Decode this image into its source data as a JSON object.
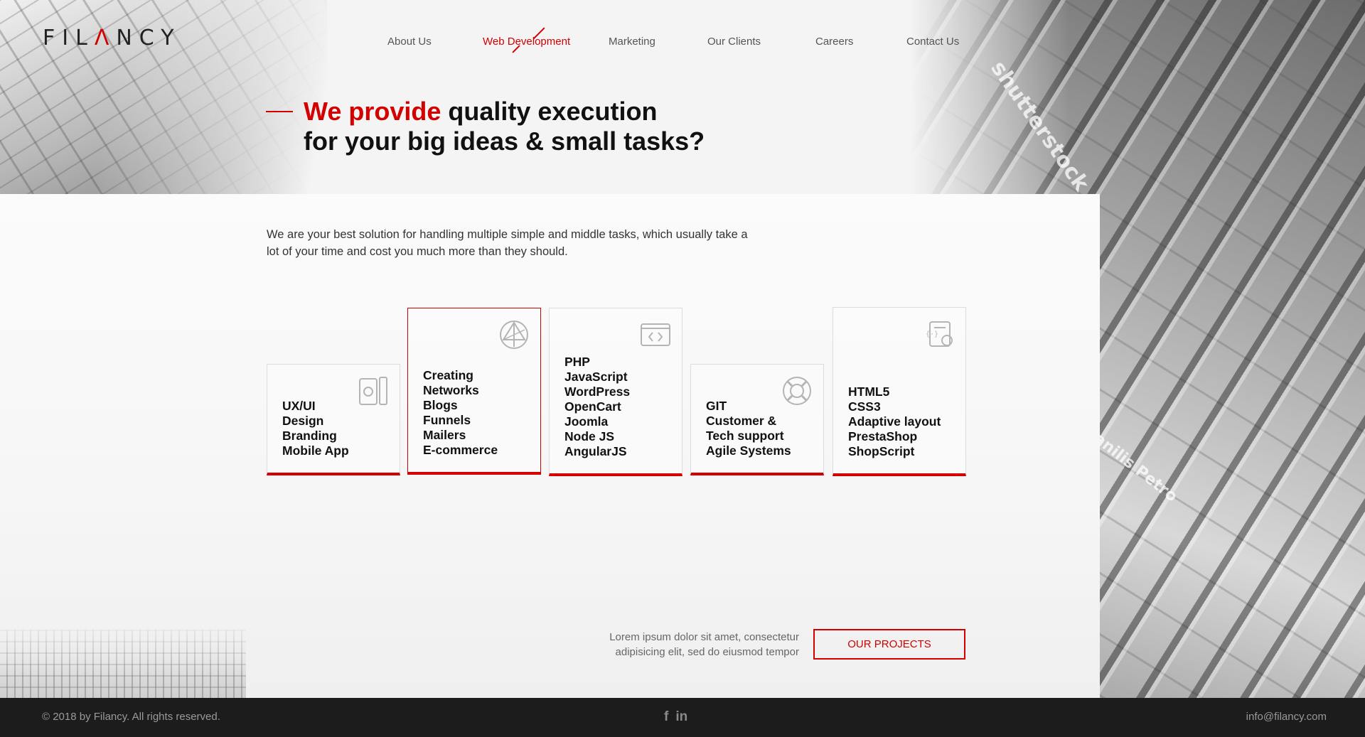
{
  "brand": {
    "logo_text_a": "FIL",
    "logo_text_accent": "Λ",
    "logo_text_b": "NCY",
    "accent_color": "#d40000"
  },
  "nav": {
    "items": [
      {
        "label": "About Us"
      },
      {
        "label": "Web Development"
      },
      {
        "label": "Marketing"
      },
      {
        "label": "Our Clients"
      },
      {
        "label": "Careers"
      },
      {
        "label": "Contact Us"
      }
    ],
    "active": "Web Development"
  },
  "hero": {
    "title_red": "We provide",
    "title_rest": " quality execution",
    "title_line2": "for your big ideas & small tasks?",
    "subtitle": "We are your best solution for handling multiple simple and middle tasks, which usually take a lot of your time and cost you much more than they should."
  },
  "cards": [
    {
      "icon": "mobile-devices-icon",
      "items": [
        "UX/UI",
        "Design",
        "Branding",
        "Mobile App"
      ]
    },
    {
      "icon": "network-globe-icon",
      "items": [
        "Creating",
        "Networks",
        "Blogs",
        "Funnels",
        "Mailers",
        "E-commerce"
      ]
    },
    {
      "icon": "code-browser-icon",
      "items": [
        "PHP",
        "JavaScript",
        "WordPress",
        "OpenCart",
        "Joomla",
        "Node JS",
        "AngularJS"
      ]
    },
    {
      "icon": "support-lifebuoy-icon",
      "items": [
        "GIT",
        "Customer &",
        "Tech support",
        "Agile Systems"
      ]
    },
    {
      "icon": "settings-code-icon",
      "items": [
        "HTML5",
        "CSS3",
        "Adaptive layout",
        "PrestaShop",
        "ShopScript"
      ]
    }
  ],
  "cta": {
    "text": "Lorem ipsum dolor sit amet, consectetur adipisicing elit, sed do eiusmod tempor",
    "button_label": "OUR PROJECTS"
  },
  "footer": {
    "copyright": "© 2018 by Filancy. All rights reserved.",
    "social": [
      {
        "icon": "facebook-icon",
        "glyph": "f"
      },
      {
        "icon": "linkedin-icon",
        "glyph": "in"
      }
    ],
    "email": "info@filancy.com"
  }
}
